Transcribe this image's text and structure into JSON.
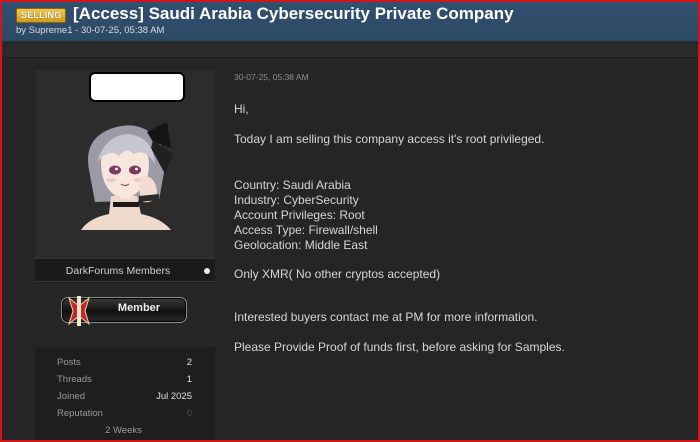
{
  "thread": {
    "prefix": "SELLING",
    "title": "[Access] Saudi Arabia Cybersecurity Private Company",
    "meta": "by Supreme1 - 30-07-25, 05:38 AM"
  },
  "user": {
    "group": "DarkForums Members",
    "rank": "Member",
    "stats": [
      {
        "label": "Posts",
        "value": "2"
      },
      {
        "label": "Threads",
        "value": "1"
      },
      {
        "label": "Joined",
        "value": "Jul 2025"
      },
      {
        "label": "Reputation",
        "value": "0"
      }
    ],
    "time_online": "2 Weeks"
  },
  "post": {
    "date": "30-07-25, 05:38 AM",
    "greeting": "Hi,",
    "intro": "Today I am selling this company access it's root privileged.",
    "details": [
      "Country: Saudi Arabia",
      "Industry: CyberSecurity",
      "Account Privileges: Root",
      "Access Type: Firewall/shell",
      "Geolocation: Middle East"
    ],
    "payment": "Only XMR( No other cryptos accepted)",
    "contact": "Interested buyers contact me at PM for more information.",
    "proof": "Please Provide Proof of funds first, before asking for Samples."
  },
  "colors": {
    "header_bg": "#31506f",
    "badge_bg": "#e0b030",
    "page_bg": "#252525",
    "panel_bg": "#1e1e1e",
    "border": "#d3141a"
  }
}
